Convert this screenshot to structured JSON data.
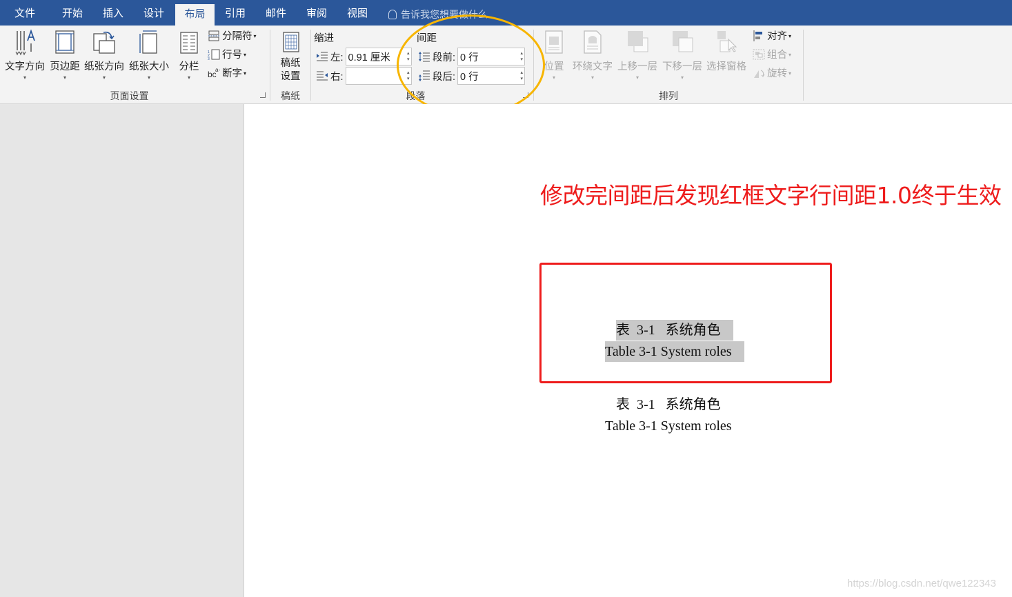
{
  "tabs": [
    "文件",
    "开始",
    "插入",
    "设计",
    "布局",
    "引用",
    "邮件",
    "审阅",
    "视图"
  ],
  "active_tab": "布局",
  "tell_me": "告诉我您想要做什么",
  "page_setup": {
    "text_direction": "文字方向",
    "margins": "页边距",
    "orientation": "纸张方向",
    "size": "纸张大小",
    "columns": "分栏",
    "breaks": "分隔符",
    "line_numbers": "行号",
    "hyphenation": "断字",
    "group_label": "页面设置"
  },
  "draft_paper": {
    "button_line1": "稿纸",
    "button_line2": "设置",
    "group_label": "稿纸"
  },
  "paragraph": {
    "indent_label": "缩进",
    "spacing_label": "间距",
    "left_label": "左:",
    "left_value": "0.91 厘米",
    "right_label": "右:",
    "right_value": "",
    "before_label": "段前:",
    "before_value": "0 行",
    "after_label": "段后:",
    "after_value": "0 行",
    "group_label": "段落"
  },
  "arrange": {
    "position": "位置",
    "wrap_text": "环绕文字",
    "bring_forward": "上移一层",
    "send_backward": "下移一层",
    "selection_pane": "选择窗格",
    "align": "对齐",
    "group": "组合",
    "rotate": "旋转",
    "group_label": "排列"
  },
  "document": {
    "annotation": "修改完间距后发现红框文字行间距1.0终于生效",
    "caption1_cn": "表  3-1   系统角色",
    "caption1_en": "Table 3-1 System roles",
    "caption2_cn": "表  3-1   系统角色",
    "caption2_en": "Table 3-1 System roles"
  },
  "watermark": "https://blog.csdn.net/qwe122343",
  "colors": {
    "ribbon_tab_bar": "#2b579a",
    "annotation_red": "#ee1c1c",
    "highlight_circle": "#f7b500",
    "selection_gray": "#c8c8c8"
  }
}
